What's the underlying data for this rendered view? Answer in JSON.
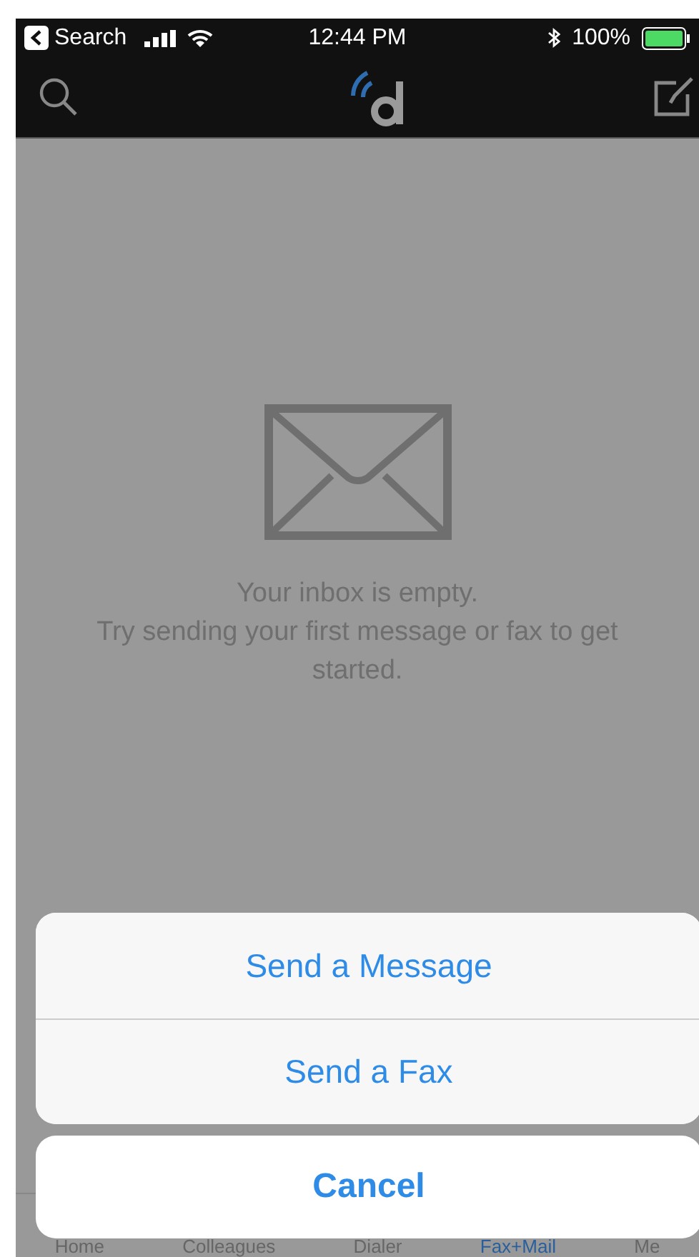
{
  "status_bar": {
    "back_label": "Search",
    "time": "12:44 PM",
    "battery": "100%"
  },
  "empty_state": {
    "lines": [
      "Your inbox is empty.",
      "Try sending your first message or fax to get started."
    ]
  },
  "tab_bar": [
    {
      "label": "Home",
      "selected": false
    },
    {
      "label": "Colleagues",
      "selected": false
    },
    {
      "label": "Dialer",
      "selected": false
    },
    {
      "label": "Fax+Mail",
      "selected": true
    },
    {
      "label": "Me",
      "selected": false
    }
  ],
  "action_sheet": {
    "actions": [
      "Send a Message",
      "Send a Fax"
    ],
    "cancel": "Cancel"
  }
}
